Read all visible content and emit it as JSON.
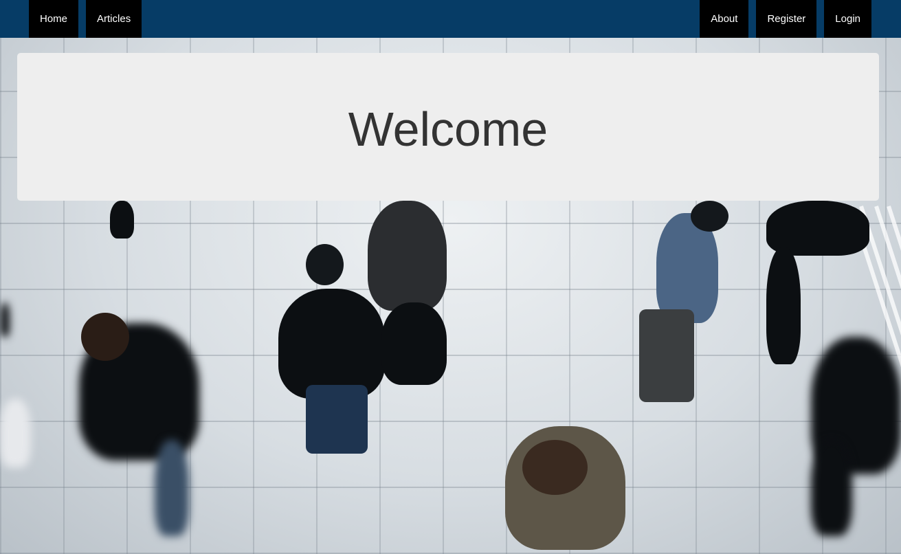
{
  "nav": {
    "left_items": [
      {
        "label": "Home"
      },
      {
        "label": "Articles"
      }
    ],
    "right_items": [
      {
        "label": "About"
      },
      {
        "label": "Register"
      },
      {
        "label": "Login"
      }
    ]
  },
  "hero": {
    "title": "Welcome"
  },
  "colors": {
    "navbar_bg": "#063c66",
    "nav_item_bg": "#000000",
    "nav_item_text": "#ffffff",
    "hero_bg": "#eeeeee",
    "hero_text": "#333333"
  },
  "background": {
    "description_icon": "crowd-photo"
  }
}
